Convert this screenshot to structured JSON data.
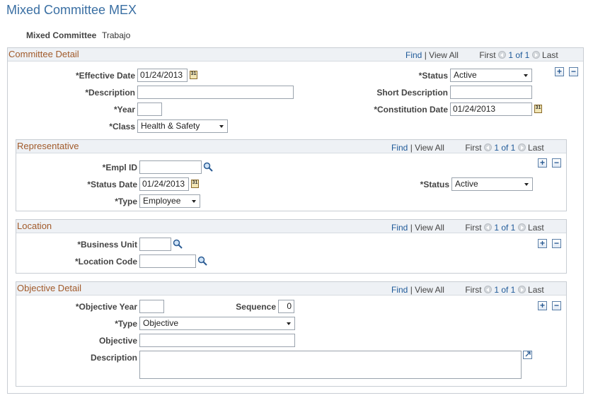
{
  "page": {
    "title": "Mixed Committee MEX"
  },
  "committee": {
    "label": "Mixed Committee",
    "value": "Trabajo"
  },
  "nav": {
    "find": "Find",
    "sep": "|",
    "view_all": "View All",
    "first": "First",
    "of": "1 of 1",
    "last": "Last"
  },
  "committee_detail": {
    "title": "Committee Detail",
    "effective_date_label": "*Effective Date",
    "effective_date": "01/24/2013",
    "status_label": "*Status",
    "status": "Active",
    "description_label": "*Description",
    "description": "",
    "short_description_label": "Short Description",
    "short_description": "",
    "year_label": "*Year",
    "year": "",
    "constitution_date_label": "*Constitution Date",
    "constitution_date": "01/24/2013",
    "class_label": "*Class",
    "class": "Health & Safety"
  },
  "representative": {
    "title": "Representative",
    "empl_id_label": "*Empl ID",
    "empl_id": "",
    "status_date_label": "*Status Date",
    "status_date": "01/24/2013",
    "status_label": "*Status",
    "status": "Active",
    "type_label": "*Type",
    "type": "Employee"
  },
  "location": {
    "title": "Location",
    "business_unit_label": "*Business Unit",
    "business_unit": "",
    "location_code_label": "*Location Code",
    "location_code": ""
  },
  "objective_detail": {
    "title": "Objective Detail",
    "objective_year_label": "*Objective Year",
    "objective_year": "",
    "sequence_label": "Sequence",
    "sequence": "0",
    "type_label": "*Type",
    "type": "Objective",
    "objective_label": "Objective",
    "objective": "",
    "description_label": "Description",
    "description": ""
  },
  "icons": {
    "calendar": "calendar-icon",
    "lookup": "magnifier-icon",
    "add": "+",
    "remove": "−"
  },
  "colors": {
    "title": "#3a6fa3",
    "section_title": "#a15a2a",
    "link": "#1f5a99",
    "header_bg": "#eef1f5"
  }
}
